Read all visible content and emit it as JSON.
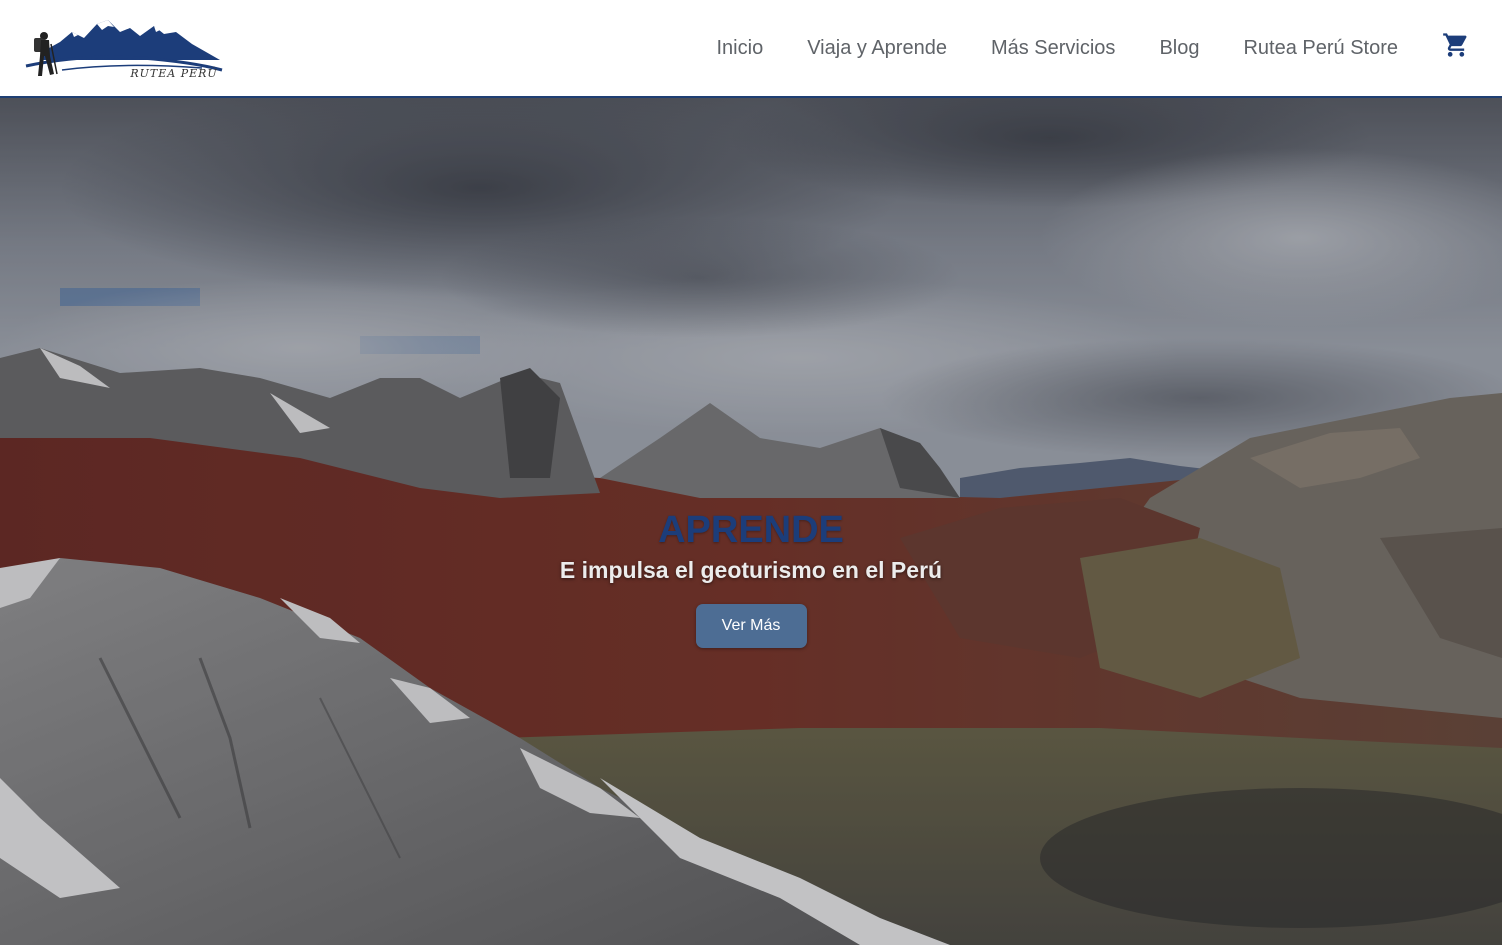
{
  "header": {
    "logo": {
      "text": "RUTEA PERÚ",
      "icon": "hiker-mountain-logo"
    },
    "nav": [
      {
        "label": "Inicio"
      },
      {
        "label": "Viaja y Aprende"
      },
      {
        "label": "Más Servicios"
      },
      {
        "label": "Blog"
      },
      {
        "label": "Rutea Perú Store"
      }
    ],
    "cart_icon": "shopping-cart-icon"
  },
  "hero": {
    "title": "APRENDE",
    "subtitle": "E impulsa el geoturismo en el Perú",
    "button_label": "Ver Más"
  },
  "colors": {
    "brand_blue": "#1c3d7a",
    "nav_text": "#5f6368",
    "button_bg": "#4d6d94",
    "header_border": "#1f3f73"
  }
}
